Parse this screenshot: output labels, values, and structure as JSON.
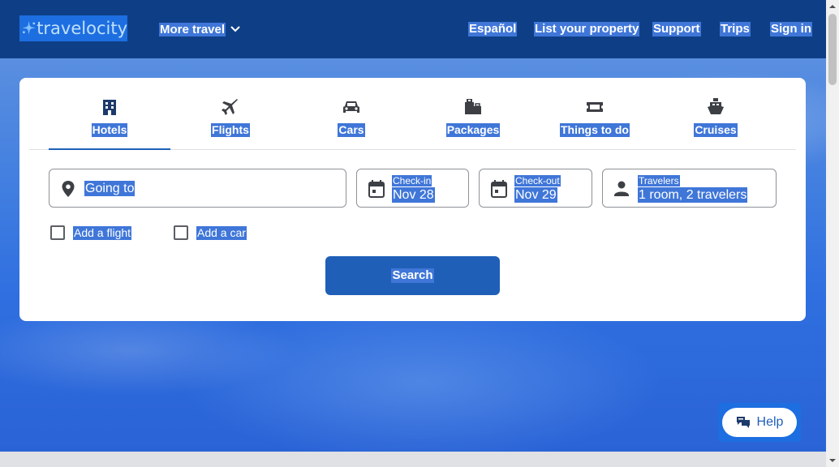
{
  "brand": {
    "name": "travelocity"
  },
  "header": {
    "more_travel": "More travel",
    "links": [
      "Español",
      "List your property",
      "Support",
      "Trips",
      "Sign in"
    ]
  },
  "tabs": [
    {
      "label": "Hotels",
      "icon": "hotel-icon",
      "active": true
    },
    {
      "label": "Flights",
      "icon": "airplane-icon"
    },
    {
      "label": "Cars",
      "icon": "car-icon"
    },
    {
      "label": "Packages",
      "icon": "luggage-icon"
    },
    {
      "label": "Things to do",
      "icon": "ticket-icon"
    },
    {
      "label": "Cruises",
      "icon": "cruise-ship-icon"
    }
  ],
  "search": {
    "destination_placeholder": "Going to",
    "checkin": {
      "label": "Check-in",
      "value": "Nov 28"
    },
    "checkout": {
      "label": "Check-out",
      "value": "Nov 29"
    },
    "travelers": {
      "label": "Travelers",
      "value": "1 room, 2 travelers"
    },
    "add_flight": "Add a flight",
    "add_car": "Add a car",
    "button": "Search"
  },
  "help": {
    "label": "Help"
  },
  "colors": {
    "header_bg": "#0e3f86",
    "accent": "#1f5fb8",
    "selection": "#3f76d8"
  }
}
